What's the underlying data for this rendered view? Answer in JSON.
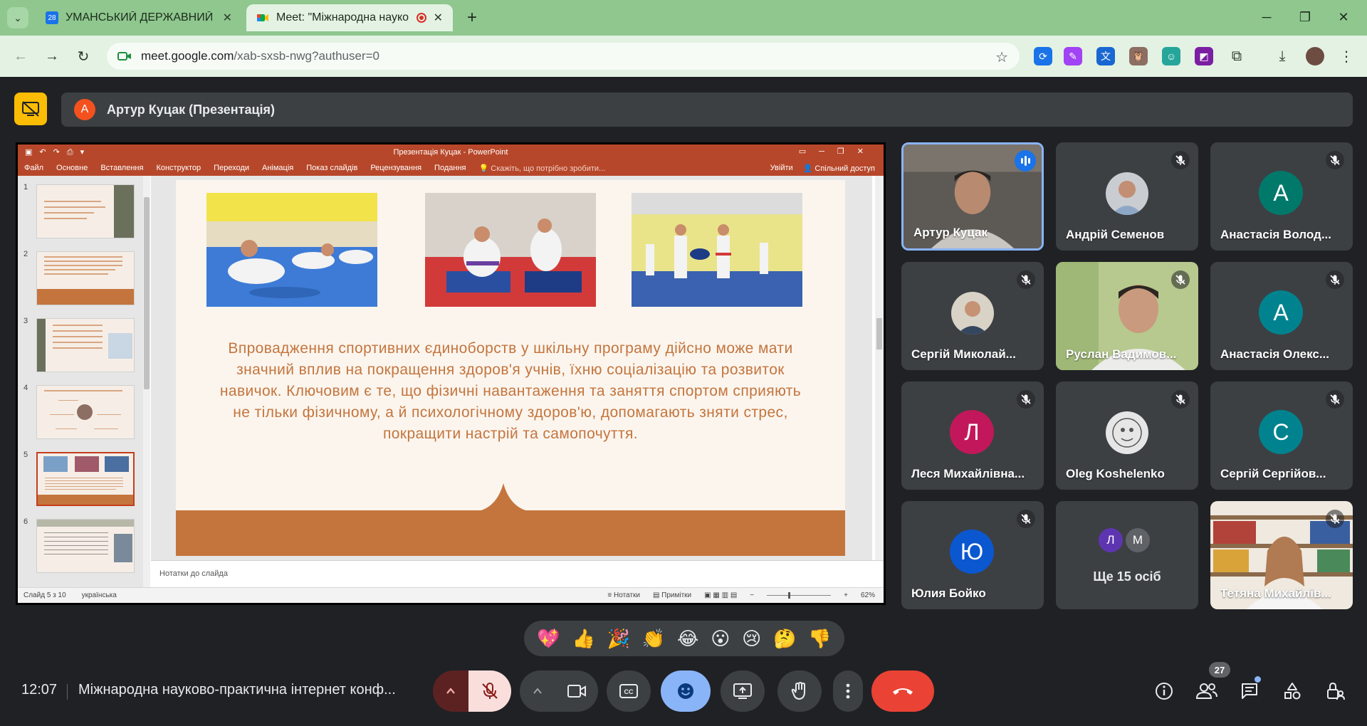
{
  "browser": {
    "tabs": [
      {
        "title": "УМАНСЬКИЙ ДЕРЖАВНИЙ ПЕ",
        "favicon_text": "28",
        "active": false
      },
      {
        "title": "Meet: \"Міжнародна науко",
        "active": true
      }
    ],
    "url_host": "meet.google.com",
    "url_path": "/xab-sxsb-nwg?authuser=0"
  },
  "presentation_banner": {
    "avatar_letter": "А",
    "label": "Артур Куцак (Презентація)"
  },
  "powerpoint": {
    "window_title": "Презентація Куцак - PowerPoint",
    "ribbon_tabs": [
      "Файл",
      "Основне",
      "Вставлення",
      "Конструктор",
      "Переходи",
      "Анімація",
      "Показ слайдів",
      "Рецензування",
      "Подання"
    ],
    "tell_me": "Скажіть, що потрібно зробити...",
    "sign_in": "Увійти",
    "share": "Спільний доступ",
    "slide_numbers": [
      "1",
      "2",
      "3",
      "4",
      "5",
      "6"
    ],
    "selected_slide": 5,
    "slide_text": "Впровадження спортивних єдиноборств у шкільну програму дійсно може мати значний вплив на покращення здоров'я учнів, їхню соціалізацію та розвиток навичок. Ключовим є те, що фізичні навантаження та заняття спортом сприяють не тільки фізичному, а й психологічному здоров'ю, допомагають зняти стрес, покращити настрій та самопочуття.",
    "notes_placeholder": "Нотатки до слайда",
    "status_slide": "Слайд 5 з 10",
    "status_language": "українська",
    "status_notes": "Нотатки",
    "status_comments": "Примітки",
    "zoom": "62%"
  },
  "participants": [
    {
      "name": "Артур Куцак",
      "type": "video",
      "speaking": true
    },
    {
      "name": "Андрій Семенов",
      "type": "photo",
      "muted": true
    },
    {
      "name": "Анастасія Волод...",
      "type": "letter",
      "letter": "А",
      "color": "#00796b",
      "muted": true
    },
    {
      "name": "Сергій Миколай...",
      "type": "photo",
      "muted": true
    },
    {
      "name": "Руслан Вадимов...",
      "type": "video",
      "muted": true
    },
    {
      "name": "Анастасія Олекс...",
      "type": "letter",
      "letter": "А",
      "color": "#00838f",
      "muted": true
    },
    {
      "name": "Леся Михайлівна...",
      "type": "letter",
      "letter": "Л",
      "color": "#c2185b",
      "muted": true
    },
    {
      "name": "Oleg Koshelenko",
      "type": "photo",
      "muted": true
    },
    {
      "name": "Сергій Сергійов...",
      "type": "letter",
      "letter": "С",
      "color": "#00838f",
      "muted": true
    },
    {
      "name": "Юлия Бойко",
      "type": "letter",
      "letter": "Ю",
      "color": "#0b57d0",
      "muted": true
    },
    {
      "name": "Тетяна Михайлів...",
      "type": "video",
      "muted": true
    }
  ],
  "more_participants": {
    "label": "Ще 15 осіб",
    "letters": [
      "Л",
      "М"
    ],
    "colors": [
      "#5e35b1",
      "#5f6368"
    ]
  },
  "reactions": [
    "💖",
    "👍",
    "🎉",
    "👏",
    "😂",
    "😮",
    "😢",
    "🤔",
    "👎"
  ],
  "bottom_bar": {
    "time": "12:07",
    "meeting_title": "Міжнародна науково-практична інтернет конф...",
    "participant_count": "27"
  },
  "colors": {
    "ppt_accent": "#b7472a",
    "slide_accent": "#c4753d",
    "end_call": "#ea4335",
    "active_control": "#8ab4f8"
  }
}
